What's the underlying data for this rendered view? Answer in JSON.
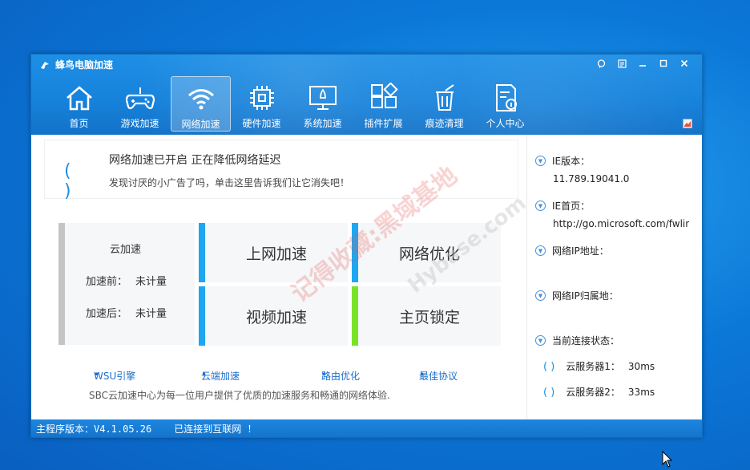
{
  "window": {
    "title": "蜂鸟电脑加速",
    "controls": [
      "speech-bubble-icon",
      "menu-icon",
      "minimize-icon",
      "maximize-icon",
      "close-icon"
    ]
  },
  "toolbar": {
    "items": [
      {
        "label": "首页",
        "icon": "home-icon"
      },
      {
        "label": "游戏加速",
        "icon": "gamepad-icon"
      },
      {
        "label": "网络加速",
        "icon": "wifi-icon",
        "active": true
      },
      {
        "label": "硬件加速",
        "icon": "chip-icon"
      },
      {
        "label": "系统加速",
        "icon": "rocket-monitor-icon"
      },
      {
        "label": "插件扩展",
        "icon": "puzzle-grid-icon"
      },
      {
        "label": "痕迹清理",
        "icon": "trash-icon"
      },
      {
        "label": "个人中心",
        "icon": "user-doc-icon"
      }
    ]
  },
  "notice": {
    "spinner": "( )",
    "title": "网络加速已开启 正在降低网络延迟",
    "subtitle": "发现讨厌的小广告了吗，单击这里告诉我们让它消失吧！"
  },
  "stats": {
    "title": "云加速",
    "before_label": "加速前：",
    "before_value": "未计量",
    "after_label": "加速后：",
    "after_value": "未计量"
  },
  "tiles": {
    "web": "上网加速",
    "optimize": "网络优化",
    "video": "视频加速",
    "homepage": "主页锁定"
  },
  "links": {
    "wsu": "WSU引擎",
    "cloud": "云端加速",
    "route": "路由优化",
    "protocol": "最佳协议"
  },
  "footer_text": "SBC云加速中心为每一位用户提供了优质的加速服务和畅通的网络体验.",
  "side": {
    "ie_version_label": "IE版本：",
    "ie_version_value": "11.789.19041.0",
    "ie_homepage_label": "IE首页：",
    "ie_homepage_value": "http://go.microsoft.com/fwlink",
    "ip_label": "网络IP地址：",
    "ip_location_label": "网络IP归属地：",
    "conn_label": "当前连接状态：",
    "server1_label": "云服务器1：",
    "server1_value": "30ms",
    "server2_label": "云服务器2：",
    "server2_value": "33ms"
  },
  "statusbar": {
    "version": "主程序版本：V4.1.05.26",
    "connection": "已连接到互联网 ！"
  },
  "watermark": {
    "text1": "记得收藏:黑域基地",
    "text2": "Hybase.com"
  },
  "colors": {
    "titlebar": "#1681da",
    "accent_blue": "#1ea7f0",
    "accent_green": "#7be22a",
    "stats_bar": "#c5c3c6"
  }
}
